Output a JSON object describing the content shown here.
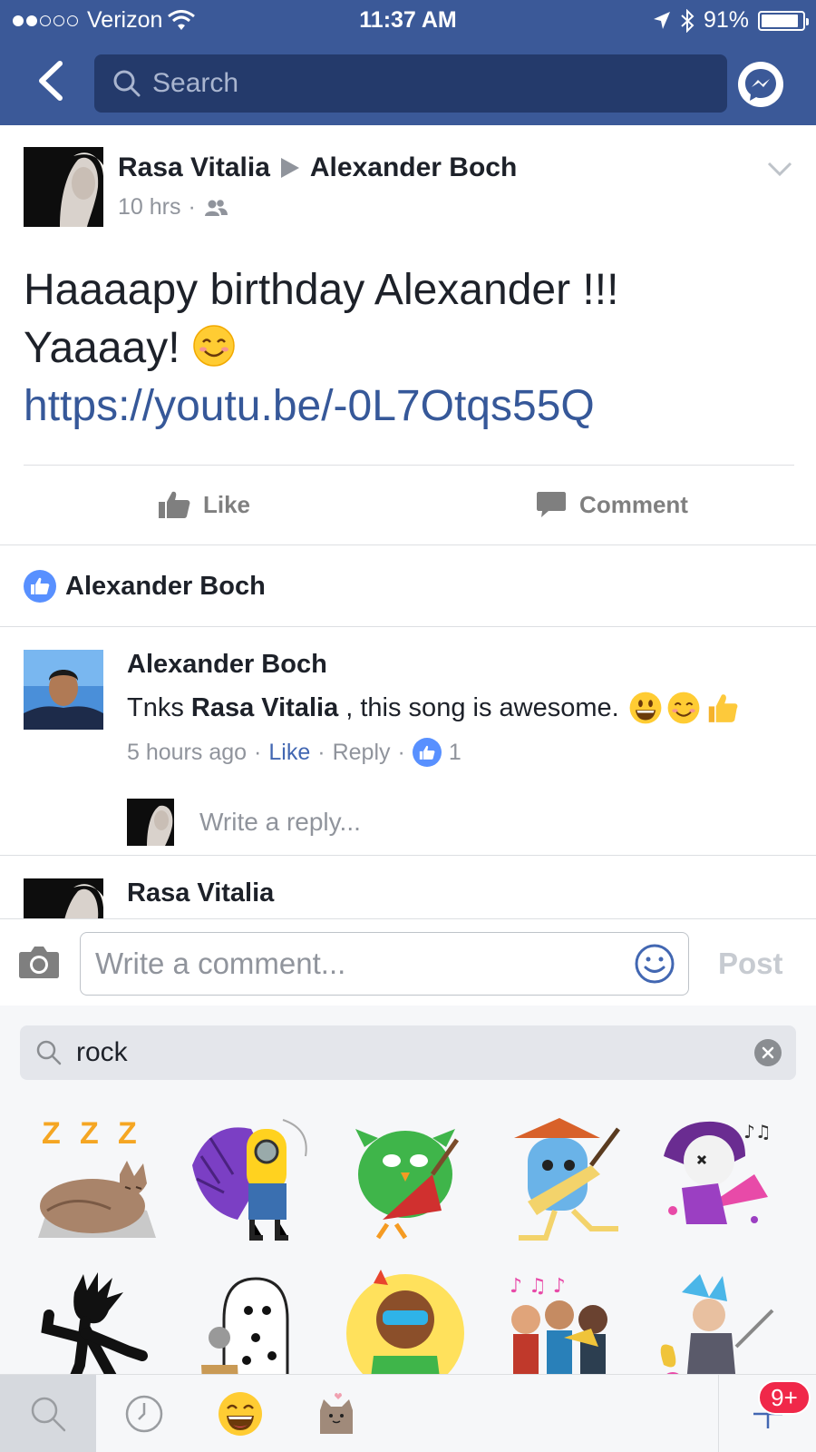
{
  "status_bar": {
    "carrier": "Verizon",
    "time": "11:37 AM",
    "battery": "91%",
    "battery_level": 0.91
  },
  "nav": {
    "search_placeholder": "Search"
  },
  "post": {
    "author": "Rasa Vitalia",
    "target": "Alexander Boch",
    "time": "10 hrs",
    "line1": "Haaaapy birthday Alexander !!!",
    "line2": "Yaaaay!",
    "link": "https://youtu.be/-0L7Otqs55Q",
    "like_label": "Like",
    "comment_label": "Comment"
  },
  "likes": {
    "name": "Alexander Boch"
  },
  "comments": [
    {
      "author": "Alexander Boch",
      "prefix": "Tnks ",
      "mention": "Rasa Vitalia",
      "suffix": " , this song is awesome.",
      "time": "5 hours ago",
      "like_label": "Like",
      "reply_label": "Reply",
      "like_count": "1"
    },
    {
      "author": "Rasa Vitalia"
    }
  ],
  "reply": {
    "placeholder": "Write a reply..."
  },
  "composer": {
    "placeholder": "Write a comment...",
    "post_label": "Post"
  },
  "sticker_tray": {
    "query": "rock",
    "stickers": [
      "sleeping-cat-sticker",
      "purple-hair-rocker-sticker",
      "green-bird-balalaika-sticker",
      "blue-creature-guitar-sticker",
      "punk-guitar-girl-sticker",
      "rock-silhouette-sticker",
      "ghost-sticker",
      "singer-sticker",
      "brass-band-sticker",
      "rocker-band-sticker"
    ],
    "notification_badge": "9+"
  },
  "colors": {
    "brand": "#3b5998",
    "link": "#365899",
    "like_blue": "#5890ff",
    "badge_red": "#f02849"
  }
}
